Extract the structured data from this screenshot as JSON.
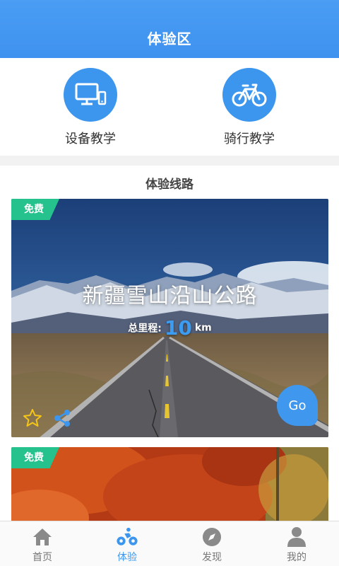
{
  "header": {
    "title": "体验区"
  },
  "teaching": [
    {
      "label": "设备教学",
      "icon": "device-monitor-phone-icon"
    },
    {
      "label": "骑行教学",
      "icon": "bicycle-icon"
    }
  ],
  "routes": {
    "title": "体验线路",
    "cards": [
      {
        "tag": "免费",
        "name": "新疆雪山沿山公路",
        "distance_label": "总里程:",
        "distance_value": "10",
        "distance_unit": "km",
        "go_label": "Go"
      },
      {
        "tag": "免费"
      }
    ]
  },
  "tabs": [
    {
      "label": "首页",
      "icon": "home-icon",
      "active": false
    },
    {
      "label": "体验",
      "icon": "cycling-icon",
      "active": true
    },
    {
      "label": "发现",
      "icon": "compass-icon",
      "active": false
    },
    {
      "label": "我的",
      "icon": "user-icon",
      "active": false
    }
  ],
  "colors": {
    "brand_blue": "#3d96ee",
    "free_green": "#25c28d",
    "star_yellow": "#f5c518"
  }
}
